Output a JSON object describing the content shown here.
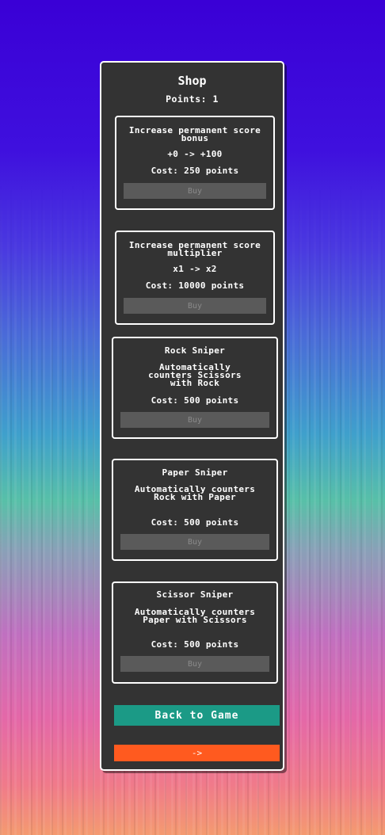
{
  "shop": {
    "title": "Shop",
    "points_label": "Points:",
    "points_value": "1",
    "back_label": "Back to Game",
    "next_label": "->"
  },
  "items": [
    {
      "name": "Increase permanent score bonus",
      "desc": "+0 -> +100",
      "cost": "Cost: 250 points",
      "buy": "Buy"
    },
    {
      "name": "Increase permanent score multiplier",
      "desc": "x1 -> x2",
      "cost": "Cost: 10000 points",
      "buy": "Buy"
    },
    {
      "name": "Rock Sniper",
      "desc": "Automatically counters Scissors with Rock",
      "cost": "Cost: 500 points",
      "buy": "Buy"
    },
    {
      "name": "Paper Sniper",
      "desc": "Automatically counters Rock with Paper",
      "cost": "Cost: 500 points",
      "buy": "Buy"
    },
    {
      "name": "Scissor Sniper",
      "desc": "Automatically counters Paper with Scissors",
      "cost": "Cost: 500 points",
      "buy": "Buy"
    }
  ],
  "colors": {
    "panel": "#333333",
    "button_disabled": "#5a5a5a",
    "back_button": "#1b9a86",
    "next_button": "#ff5a1f"
  }
}
